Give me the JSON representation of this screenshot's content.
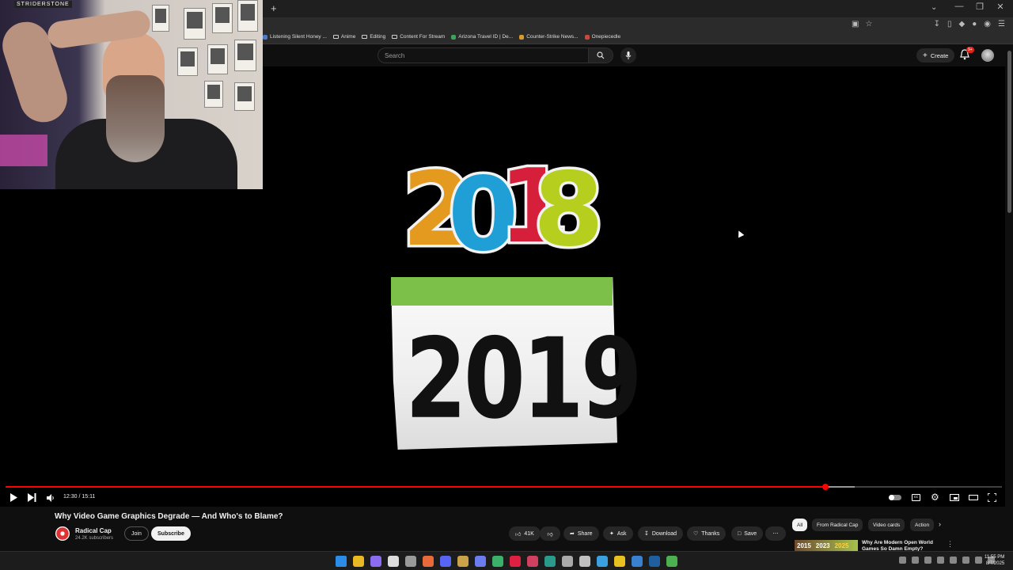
{
  "browser": {
    "new_tab_symbol": "+",
    "bookmarks": [
      {
        "label": "Listening Silent Honey ...",
        "kind": "favicon",
        "color": "#4a7bd0"
      },
      {
        "label": "Anime",
        "kind": "folder"
      },
      {
        "label": "Editing",
        "kind": "folder"
      },
      {
        "label": "Content For Stream",
        "kind": "folder"
      },
      {
        "label": "Arizona Travel ID | De...",
        "kind": "favicon",
        "color": "#3aa55a"
      },
      {
        "label": "Counter-Strike News...",
        "kind": "favicon",
        "color": "#d99a2b"
      },
      {
        "label": "Onepiecedle",
        "kind": "favicon",
        "color": "#c94a3a"
      }
    ]
  },
  "header": {
    "search_placeholder": "Search",
    "create_label": "Create",
    "notification_badge": "9+"
  },
  "video": {
    "graphic_top_year": [
      "2",
      "0",
      "1",
      "8"
    ],
    "graphic_top_colors": [
      "#e39a1e",
      "#1f9fd6",
      "#d61f3a",
      "#b6cf1f"
    ],
    "calendar_year": "2019",
    "calendar_tab_color": "#7cc04a",
    "current_time": "12:30",
    "duration": "15:11",
    "progress": 0.823,
    "buffered": 0.852
  },
  "webcam": {
    "label": "STRIDERSTONE"
  },
  "details": {
    "title": "Why Video Game Graphics Degrade — And Who's to Blame?",
    "channel_name": "Radical Cap",
    "subscribers": "24.2K subscribers",
    "join_label": "Join",
    "subscribe_label": "Subscribe",
    "like_count": "41K",
    "share_label": "Share",
    "ask_label": "Ask",
    "download_label": "Download",
    "thanks_label": "Thanks",
    "save_label": "Save"
  },
  "chips": [
    "All",
    "From Radical Cap",
    "Video cards",
    "Action"
  ],
  "recommendation": {
    "thumb_years": [
      "2015",
      "2023",
      "2025"
    ],
    "title": "Why Are Modern Open World Games So Damn Empty?"
  },
  "taskbar": {
    "app_colors": [
      "#2b8de8",
      "#e8b923",
      "#8a6cf0",
      "#dddddd",
      "#9a9a9a",
      "#e86a3a",
      "#5865f2",
      "#caa24a",
      "#6a7cf0",
      "#3ab06a",
      "#e02040",
      "#d04060",
      "#2a9a8a",
      "#aaaaaa",
      "#c0c0c0",
      "#3aa0e0",
      "#e8c020",
      "#3a80d0",
      "#1f5fa0",
      "#4caf50"
    ],
    "time": "11:55 PM",
    "date": "8/7/2025"
  }
}
